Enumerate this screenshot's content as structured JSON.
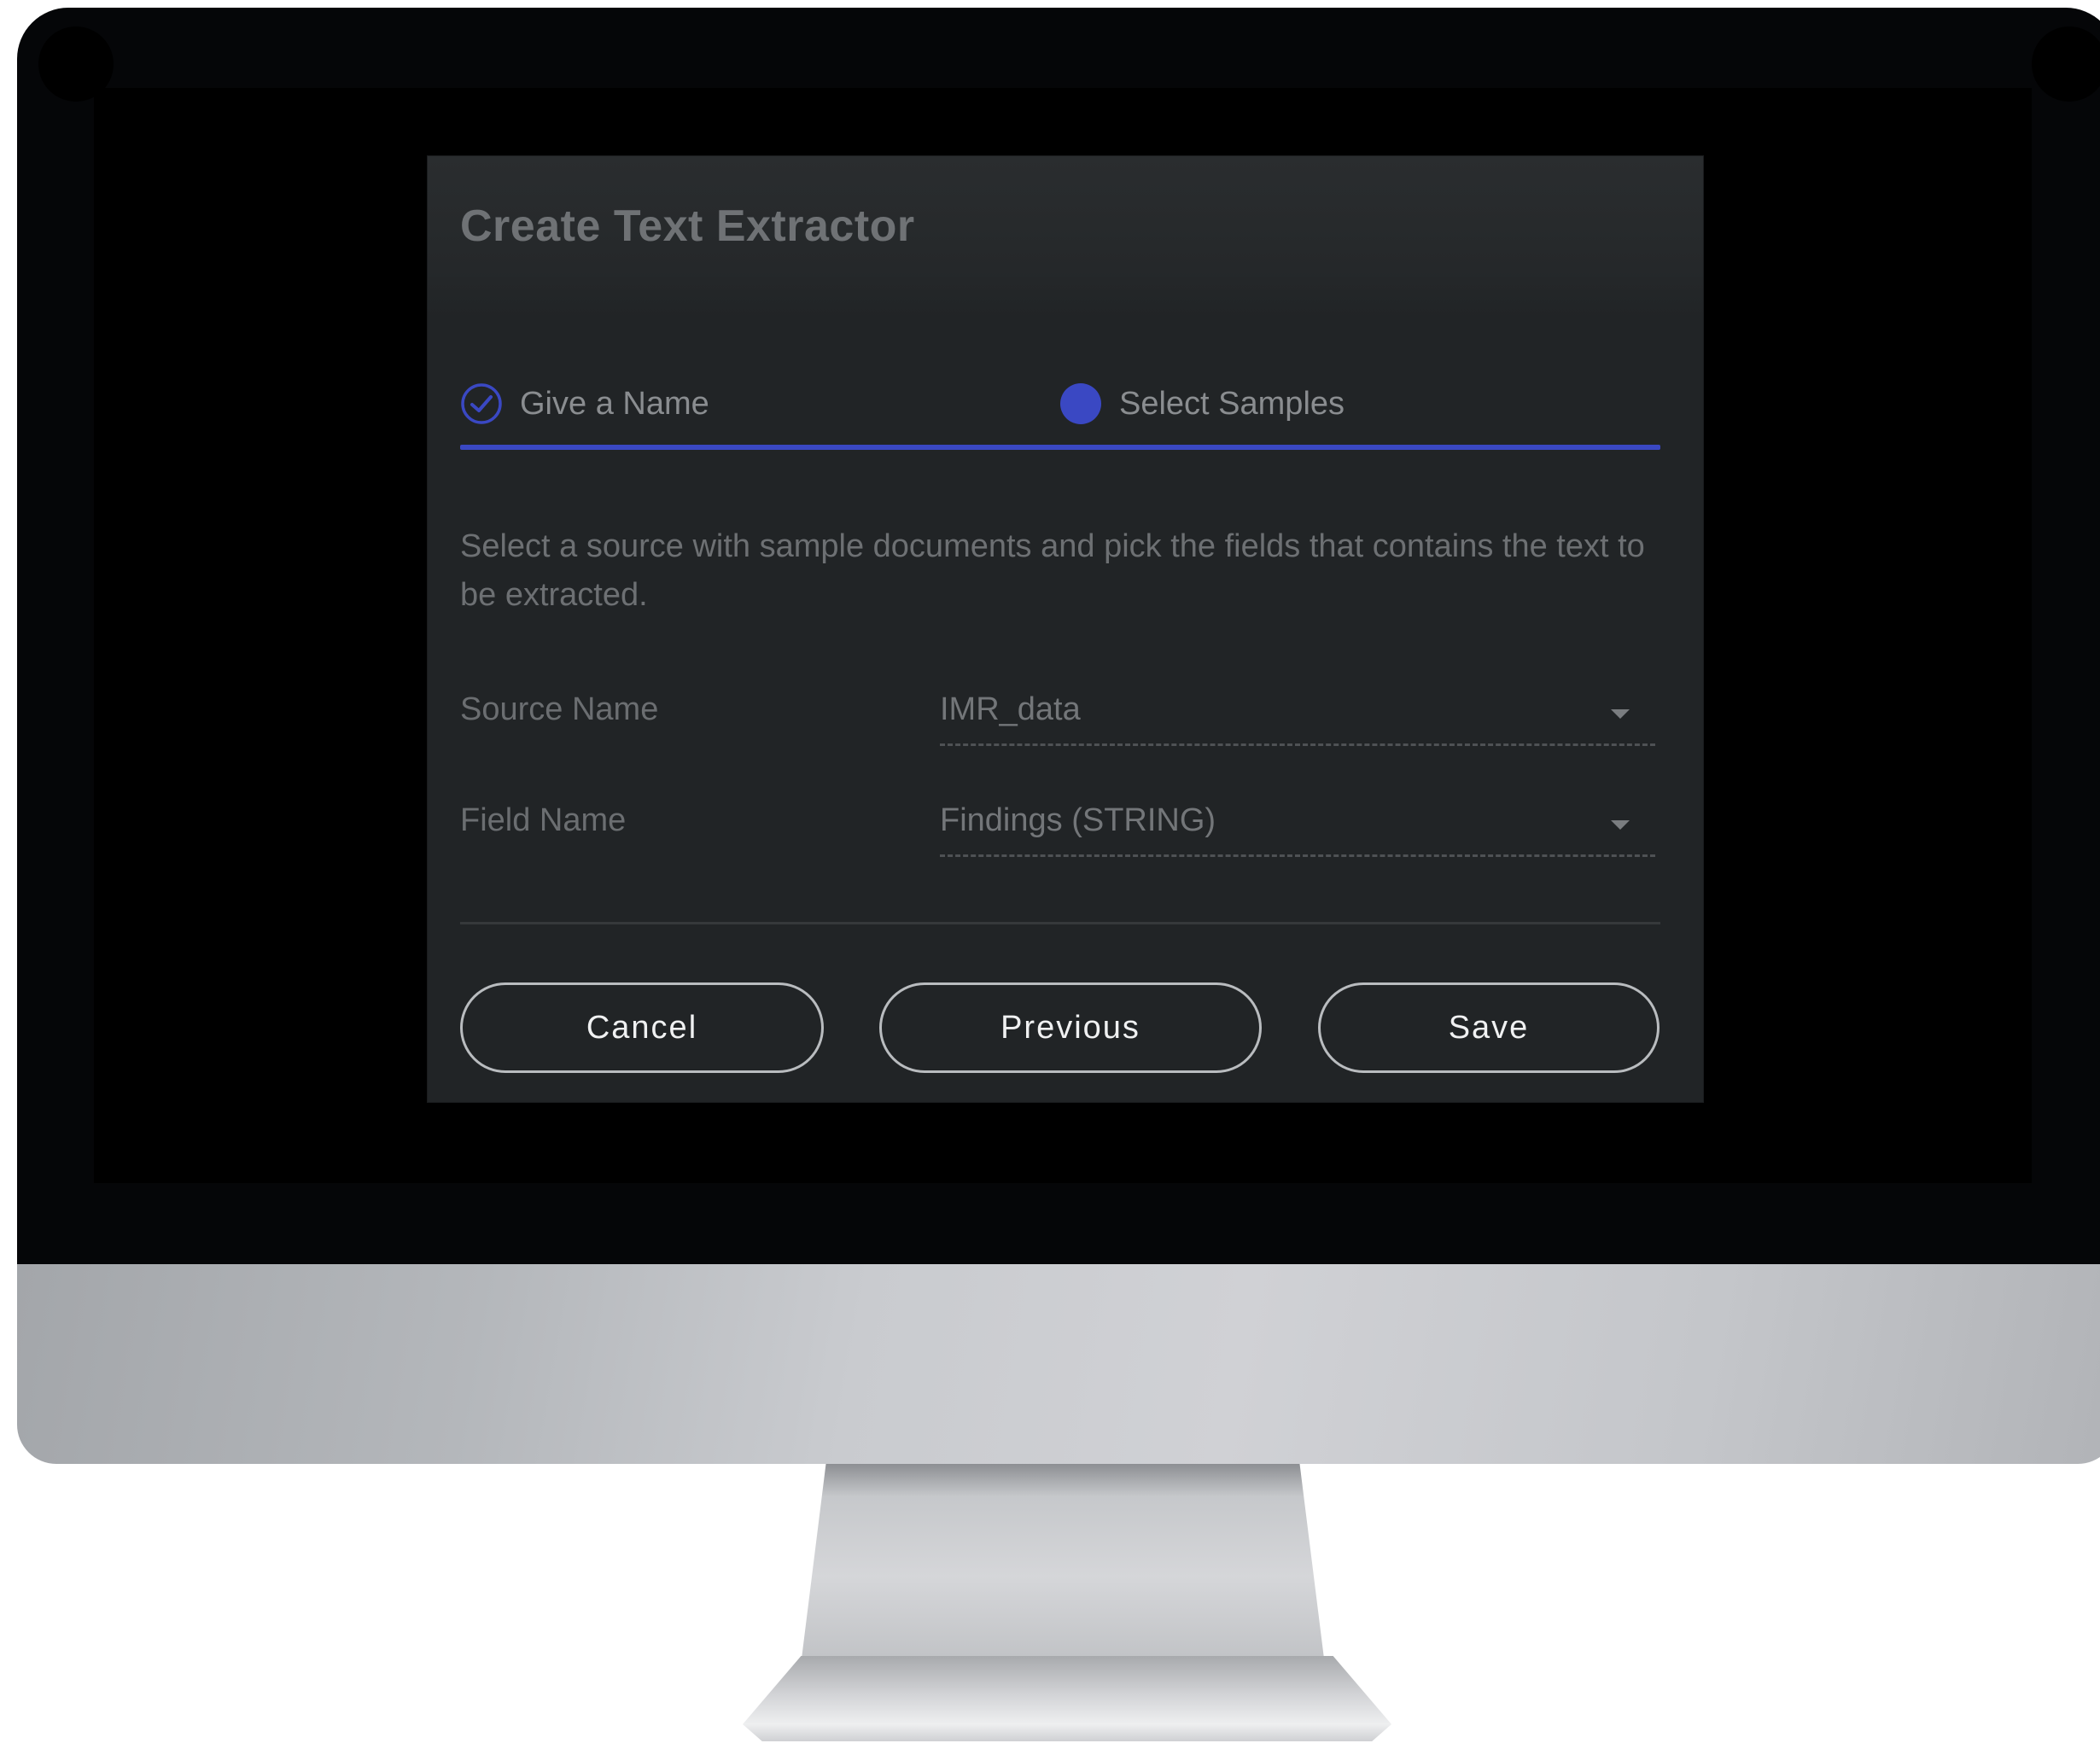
{
  "dialog": {
    "title": "Create Text Extractor",
    "steps": [
      {
        "label": "Give a Name",
        "state": "completed",
        "icon": "check-circle-icon"
      },
      {
        "label": "Select Samples",
        "state": "active",
        "icon": "active-step-dot-icon"
      }
    ],
    "description": "Select a source with sample documents and pick the fields that contains the text to be extracted.",
    "form": {
      "source": {
        "label": "Source Name",
        "value": "IMR_data"
      },
      "field": {
        "label": "Field Name",
        "value": "Findings (STRING)"
      }
    },
    "buttons": {
      "cancel": "Cancel",
      "previous": "Previous",
      "save": "Save"
    }
  },
  "colors": {
    "accent": "#3a48c3",
    "dialog_background": "#212426",
    "screen_background": "#000000",
    "button_border": "#b9bcbf"
  }
}
